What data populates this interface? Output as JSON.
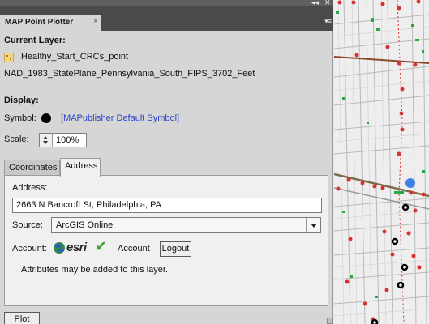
{
  "panel": {
    "title": "MAP Point Plotter",
    "close_glyph": "×",
    "collapse_glyph": "◂◂",
    "close_window_glyph": "✕",
    "menu_glyph": "▾≡"
  },
  "current_layer": {
    "heading": "Current Layer:",
    "layer_name": "Healthy_Start_CRCs_point",
    "icon": "point-layer-icon",
    "projection": "NAD_1983_StatePlane_Pennsylvania_South_FIPS_3702_Feet"
  },
  "display": {
    "heading": "Display:",
    "symbol_label": "Symbol:",
    "symbol_link": "[MAPublisher Default Symbol]",
    "scale_label": "Scale:",
    "scale_value": "100%"
  },
  "tabs": [
    {
      "label": "Coordinates",
      "active": false
    },
    {
      "label": "Address",
      "active": true
    }
  ],
  "address_tab": {
    "address_label": "Address:",
    "address_value": "2663 N Bancroft St, Philadelphia, PA",
    "source_label": "Source:",
    "source_value": "ArcGIS Online",
    "account_label": "Account:",
    "esri_logo_text": "esri",
    "check_glyph": "✔",
    "account_text": "Account",
    "logout_label": "Logout",
    "attributes_note": "Attributes may be added to this layer."
  },
  "plot_label": "Plot",
  "colors": {
    "panel_bg": "#d6d6d6",
    "tab_strip": "#4a4a4a",
    "link": "#2a43c8",
    "map_bg": "#eeeeee",
    "road_major": "#8a4a2a",
    "point_red": "#d93030",
    "point_green": "#2aa845",
    "plotted_point_blue": "#3e7fe6"
  }
}
